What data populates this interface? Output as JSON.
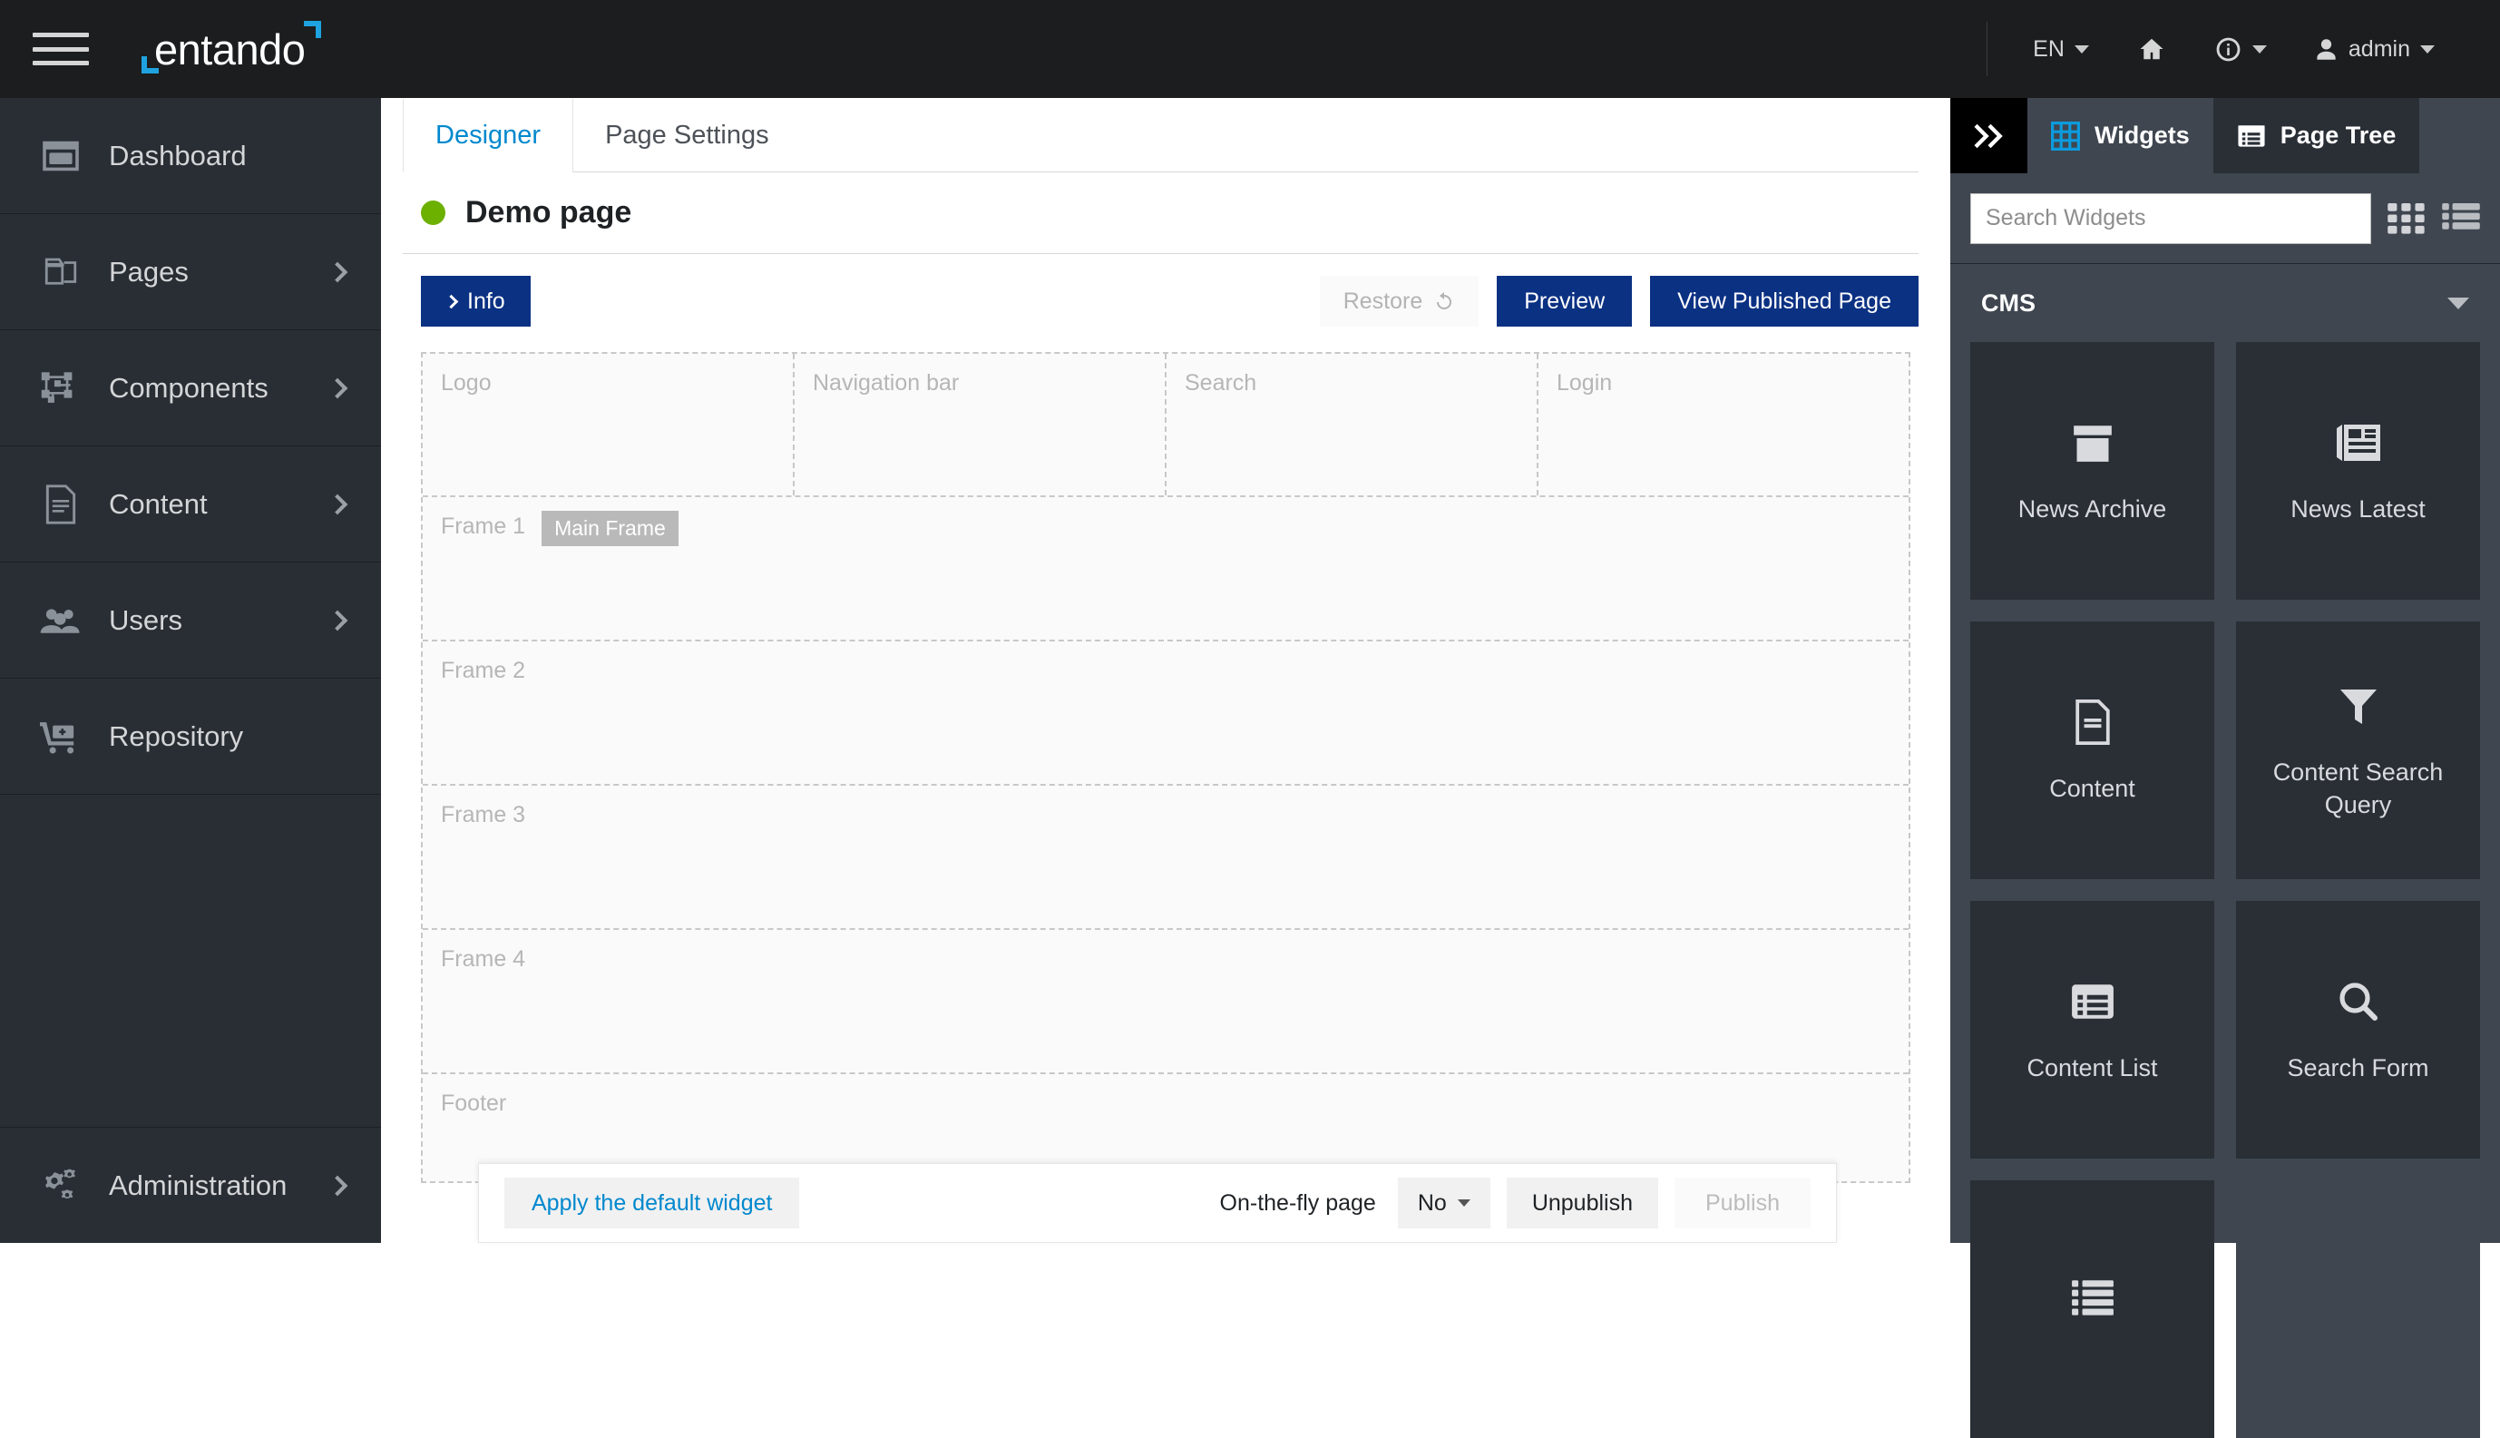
{
  "topbar": {
    "brand": "entando",
    "menu_icon": "hamburger-icon",
    "language": "EN",
    "home_icon": "home-icon",
    "info_icon": "info-circle-icon",
    "user": "admin"
  },
  "sidebar": {
    "items": [
      {
        "label": "Dashboard",
        "icon": "dashboard-icon",
        "has_chevron": false
      },
      {
        "label": "Pages",
        "icon": "pages-icon",
        "has_chevron": true
      },
      {
        "label": "Components",
        "icon": "components-icon",
        "has_chevron": true
      },
      {
        "label": "Content",
        "icon": "content-file-icon",
        "has_chevron": true
      },
      {
        "label": "Users",
        "icon": "users-icon",
        "has_chevron": true
      },
      {
        "label": "Repository",
        "icon": "repository-cart-icon",
        "has_chevron": false
      },
      {
        "label": "Administration",
        "icon": "gears-icon",
        "has_chevron": true
      }
    ]
  },
  "center": {
    "tabs": [
      {
        "label": "Designer",
        "active": true
      },
      {
        "label": "Page Settings",
        "active": false
      }
    ],
    "page_title": "Demo page",
    "status_color": "#6cb000",
    "buttons": {
      "info": "Info",
      "restore": "Restore",
      "restore_icon": "undo-icon",
      "preview": "Preview",
      "view_published": "View Published Page"
    },
    "frames": {
      "top_row": [
        "Logo",
        "Navigation bar",
        "Search",
        "Login"
      ],
      "rows": [
        {
          "label": "Frame 1",
          "badge": "Main Frame"
        },
        {
          "label": "Frame 2",
          "badge": ""
        },
        {
          "label": "Frame 3",
          "badge": ""
        },
        {
          "label": "Frame 4",
          "badge": ""
        },
        {
          "label": "Footer",
          "badge": ""
        }
      ]
    }
  },
  "bottom_bar": {
    "apply_default": "Apply the default widget",
    "onthefly_label": "On-the-fly page",
    "onthefly_value": "No",
    "unpublish": "Unpublish",
    "publish": "Publish"
  },
  "right_panel": {
    "collapse_icon": "double-chevron-right-icon",
    "tabs": [
      {
        "label": "Widgets",
        "icon": "grid-icon",
        "active": true
      },
      {
        "label": "Page Tree",
        "icon": "list-alt-icon",
        "active": false
      }
    ],
    "search_placeholder": "Search Widgets",
    "grid_view_icon": "grid-view-icon",
    "list_view_icon": "list-view-icon",
    "section_title": "CMS",
    "widgets": [
      {
        "label": "News Archive",
        "icon": "archive-icon"
      },
      {
        "label": "News Latest",
        "icon": "newspaper-icon"
      },
      {
        "label": "Content",
        "icon": "file-text-icon"
      },
      {
        "label": "Content Search Query",
        "icon": "filter-icon"
      },
      {
        "label": "Content List",
        "icon": "list-alt-icon"
      },
      {
        "label": "Search Form",
        "icon": "search-icon"
      },
      {
        "label": "",
        "icon": "list-ul-icon"
      },
      {
        "label": "",
        "icon": ""
      }
    ]
  },
  "colors": {
    "brand_blue": "#1fa3e0",
    "accent_blue": "#0088ce",
    "primary_button": "#0b3183",
    "sidebar_bg": "#292e34",
    "panel_bg": "#3f4650",
    "card_bg": "#2a2f36"
  }
}
